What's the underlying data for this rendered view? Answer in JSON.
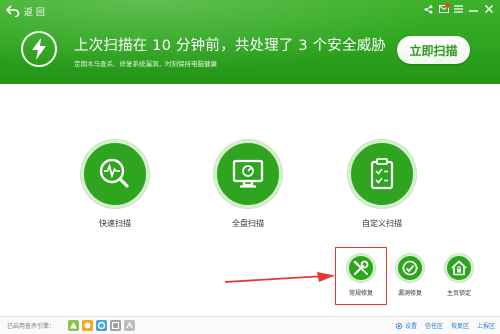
{
  "header": {
    "back_label": "返 回",
    "headline": "上次扫描在 10 分钟前，共处理了 3 个安全威胁",
    "subline": "定期木马查杀、修复系统漏洞，时刻保持电脑健康",
    "scan_now_label": "立即扫描",
    "window_controls": [
      "share-icon",
      "mail-icon",
      "menu-icon",
      "minimize-icon",
      "close-icon"
    ]
  },
  "scan_options": [
    {
      "label": "快速扫描",
      "icon": "activity-monitor-icon"
    },
    {
      "label": "全盘扫描",
      "icon": "monitor-icon"
    },
    {
      "label": "自定义扫描",
      "icon": "checklist-icon"
    }
  ],
  "tools": [
    {
      "label": "常规修复",
      "icon": "wrench-screwdriver-icon",
      "highlighted": true
    },
    {
      "label": "漏洞修复",
      "icon": "bug-fix-icon"
    },
    {
      "label": "主页锁定",
      "icon": "home-lock-icon"
    }
  ],
  "footer": {
    "engines_label": "已启用查杀引擎：",
    "settings_label": "设置",
    "trust_label": "信任区",
    "restore_label": "恢复区",
    "report_label": "上报区"
  },
  "colors": {
    "brand_green": "#2ea41f",
    "highlight_red": "#e53935",
    "link_blue": "#2a7bd1"
  }
}
